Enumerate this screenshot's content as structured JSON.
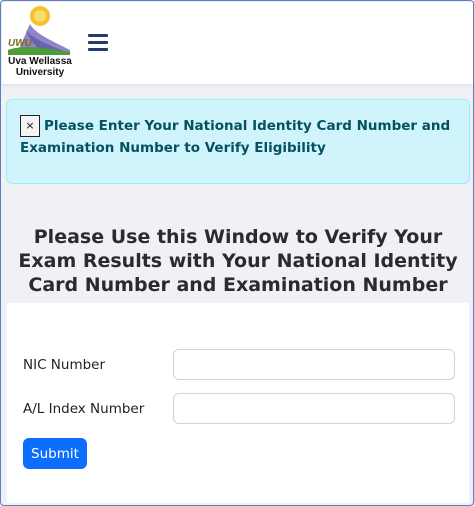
{
  "header": {
    "logo_abbr": "UWU",
    "logo_name_line1": "Uva Wellassa",
    "logo_name_line2": "University",
    "menu_icon": "hamburger-icon"
  },
  "alert": {
    "close_label": "×",
    "message": "Please Enter Your National Identity Card Number and Examination Number to Verify Eligibility"
  },
  "main": {
    "heading": "Please Use this Window to Verify Your Exam Results with Your National Identity Card Number and Examination Number"
  },
  "form": {
    "nic_label": "NIC Number",
    "nic_value": "",
    "index_label": "A/L Index Number",
    "index_value": "",
    "submit_label": "Submit"
  },
  "colors": {
    "alert_bg": "#cff4fc",
    "alert_text": "#055160",
    "primary": "#0d6efd",
    "menu_icon": "#233a6e"
  }
}
